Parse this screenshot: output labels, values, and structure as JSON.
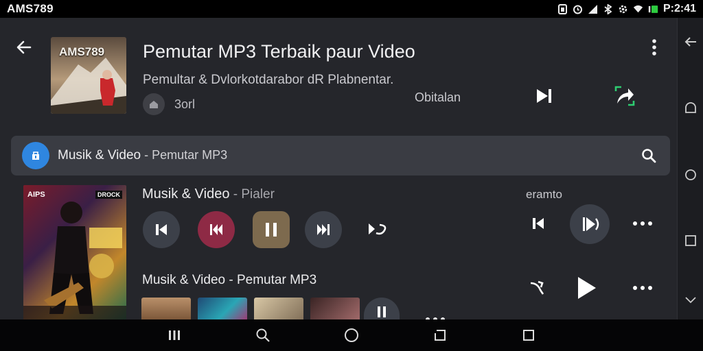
{
  "status_bar": {
    "carrier": "AMS789",
    "clock": "P:2:41"
  },
  "header": {
    "album_art_text": "AMS789",
    "title": "Pemutar MP3 Terbaik paur Video",
    "subtitle": "Pemultar & Dvlorkotdarabor dR Plabnentar.",
    "chip_label": "3orl",
    "option_label": "Obitalan"
  },
  "search": {
    "label": "Musik & Video",
    "sub": " - Pemutar MP3"
  },
  "now_playing": {
    "cover_left": "AIPS",
    "cover_right": "DROCK",
    "title": "Musik & Video",
    "title_sub": " - Pialer",
    "right_label": "eramto"
  },
  "second_row": {
    "title": "Musik & Video - Pemutar MP3"
  },
  "colors": {
    "accent_blue": "#2f86e0",
    "accent_red": "#8e2a45",
    "accent_gold": "#7d6a4e",
    "accent_green": "#2ecc71"
  },
  "icons": [
    "back-arrow-icon",
    "more-vert-icon",
    "skip-next-icon",
    "share-icon",
    "search-icon",
    "music-badge-icon",
    "skip-previous-icon",
    "rewind-icon",
    "pause-icon",
    "fast-forward-icon",
    "repeat-icon",
    "play-icon",
    "more-horiz-icon"
  ]
}
